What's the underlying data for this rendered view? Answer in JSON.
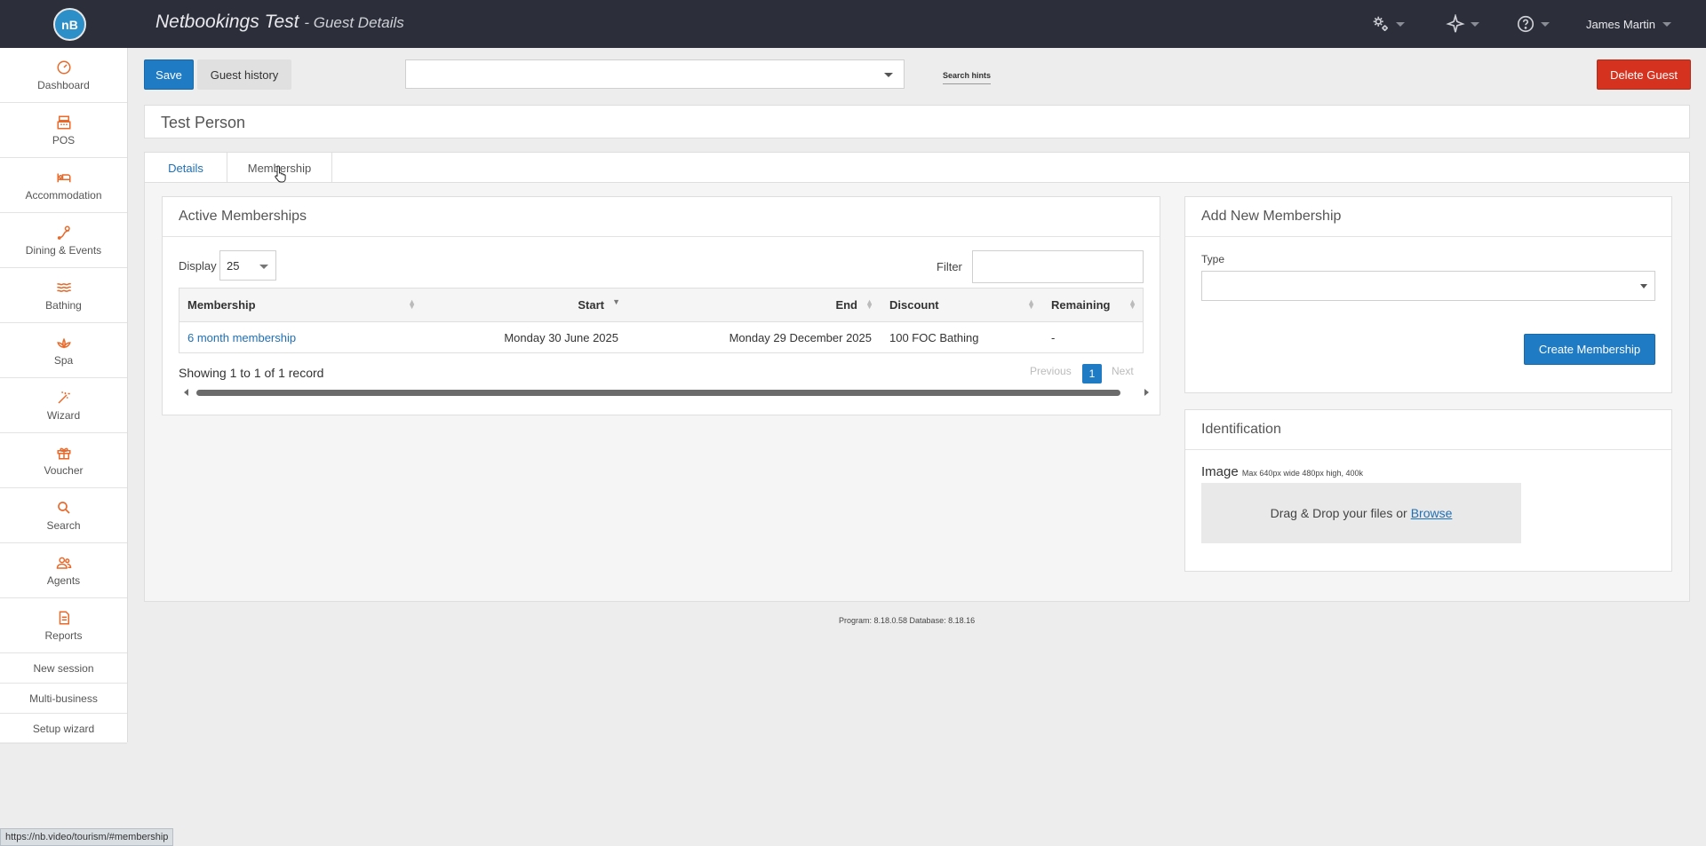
{
  "app": {
    "logo_text": "nB",
    "title": "Netbookings Test",
    "subtitle": "- Guest Details",
    "user_name": "James Martin"
  },
  "topbar_icons": [
    "settings-gears-icon",
    "plane-icon",
    "help-circle-icon"
  ],
  "sidebar": {
    "items": [
      {
        "label": "Dashboard",
        "icon": "dashboard-icon"
      },
      {
        "label": "POS",
        "icon": "register-icon"
      },
      {
        "label": "Accommodation",
        "icon": "bed-icon"
      },
      {
        "label": "Dining & Events",
        "icon": "dining-icon"
      },
      {
        "label": "Bathing",
        "icon": "waves-icon"
      },
      {
        "label": "Spa",
        "icon": "lotus-icon"
      },
      {
        "label": "Wizard",
        "icon": "magic-wand-icon"
      },
      {
        "label": "Voucher",
        "icon": "gift-icon"
      },
      {
        "label": "Search",
        "icon": "search-icon"
      },
      {
        "label": "Agents",
        "icon": "users-icon"
      },
      {
        "label": "Reports",
        "icon": "document-icon"
      }
    ],
    "links": [
      "New session",
      "Multi-business",
      "Setup wizard"
    ],
    "icon_color": "#e8692a"
  },
  "toolbar": {
    "save_label": "Save",
    "history_label": "Guest history",
    "guest_select_value": "",
    "search_hints_label": "Search hints",
    "delete_label": "Delete Guest"
  },
  "guest": {
    "name": "Test Person"
  },
  "tabs": {
    "details": "Details",
    "membership": "Membership",
    "active": "membership"
  },
  "active_memberships": {
    "title": "Active Memberships",
    "display_label": "Display",
    "display_value": "25",
    "filter_label": "Filter",
    "filter_value": "",
    "columns": [
      "Membership",
      "Start",
      "End",
      "Discount",
      "Remaining"
    ],
    "rows": [
      {
        "membership": "6 month membership",
        "start": "Monday 30 June 2025",
        "end": "Monday 29 December 2025",
        "discount": "100 FOC Bathing",
        "remaining": "-"
      }
    ],
    "showing_text": "Showing 1 to 1 of 1 record",
    "pager": {
      "previous": "Previous",
      "page": "1",
      "next": "Next"
    }
  },
  "add_membership": {
    "title": "Add New Membership",
    "type_label": "Type",
    "type_value": "",
    "create_label": "Create Membership"
  },
  "identification": {
    "title": "Identification",
    "image_label": "Image",
    "image_hint": "Max 640px wide 480px high, 400k",
    "drop_text": "Drag & Drop your files or",
    "browse_label": "Browse"
  },
  "footer": {
    "version": "Program: 8.18.0.58 Database: 8.18.16"
  },
  "status_url": "https://nb.video/tourism/#membership",
  "colors": {
    "primary": "#1f7bc4",
    "danger": "#d5331f",
    "topbar": "#2c2f3a"
  }
}
